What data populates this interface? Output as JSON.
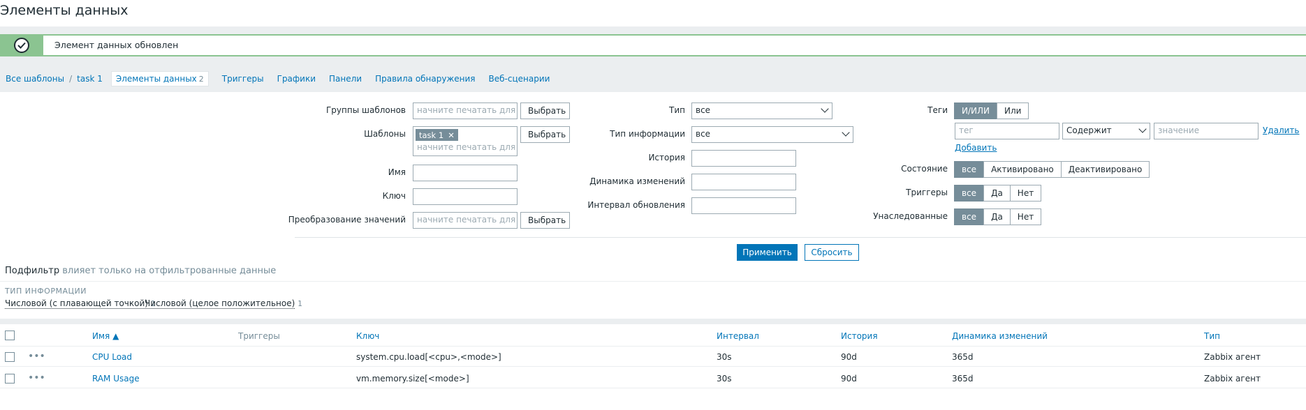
{
  "page": {
    "title": "Элементы данных"
  },
  "message": {
    "text": "Элемент данных обновлен"
  },
  "breadcrumbs": {
    "all_templates": "Все шаблоны",
    "separator": "/",
    "template": "task 1",
    "active_tab": "Элементы данных",
    "active_tab_count": "2",
    "tabs": [
      "Триггеры",
      "Графики",
      "Панели",
      "Правила обнаружения",
      "Веб-сценарии"
    ]
  },
  "filter": {
    "template_groups": {
      "label": "Группы шаблонов",
      "placeholder": "начните печатать для по",
      "button": "Выбрать"
    },
    "templates": {
      "label": "Шаблоны",
      "chip": "task 1",
      "placeholder": "начните печатать для по",
      "button": "Выбрать"
    },
    "name": {
      "label": "Имя",
      "value": ""
    },
    "key": {
      "label": "Ключ",
      "value": ""
    },
    "value_mapping": {
      "label": "Преобразование значений",
      "placeholder": "начните печатать для по",
      "button": "Выбрать"
    },
    "type": {
      "label": "Тип",
      "value": "все"
    },
    "info_type": {
      "label": "Тип информации",
      "value": "все"
    },
    "history": {
      "label": "История",
      "value": ""
    },
    "trends": {
      "label": "Динамика изменений",
      "value": ""
    },
    "update_interval": {
      "label": "Интервал обновления",
      "value": ""
    },
    "tags": {
      "label": "Теги",
      "modes": [
        "И/ИЛИ",
        "Или"
      ],
      "tag_placeholder": "тег",
      "operator": "Содержит",
      "value_placeholder": "значение",
      "remove": "Удалить",
      "add": "Добавить"
    },
    "state": {
      "label": "Состояние",
      "options": [
        "все",
        "Активировано",
        "Деактивировано"
      ]
    },
    "triggers": {
      "label": "Триггеры",
      "options": [
        "все",
        "Да",
        "Нет"
      ]
    },
    "inherited": {
      "label": "Унаследованные",
      "options": [
        "все",
        "Да",
        "Нет"
      ]
    },
    "apply": "Применить",
    "reset": "Сбросить"
  },
  "subfilter": {
    "title": "Подфильтр",
    "note": "влияет только на отфильтрованные данные",
    "section": "ТИП ИНФОРМАЦИИ",
    "items": [
      {
        "label": "Числовой (с плавающей точкой)",
        "count": "1"
      },
      {
        "label": "Числовой (целое положительное)",
        "count": "1"
      }
    ]
  },
  "table": {
    "columns": {
      "name": "Имя ▲",
      "triggers": "Триггеры",
      "key": "Ключ",
      "interval": "Интервал",
      "history": "История",
      "trends": "Динамика изменений",
      "type": "Тип"
    },
    "rows": [
      {
        "name": "CPU Load",
        "key": "system.cpu.load[<cpu>,<mode>]",
        "interval": "30s",
        "history": "90d",
        "trends": "365d",
        "type": "Zabbix агент"
      },
      {
        "name": "RAM Usage",
        "key": "vm.memory.size[<mode>]",
        "interval": "30s",
        "history": "90d",
        "trends": "365d",
        "type": "Zabbix агент"
      }
    ]
  }
}
